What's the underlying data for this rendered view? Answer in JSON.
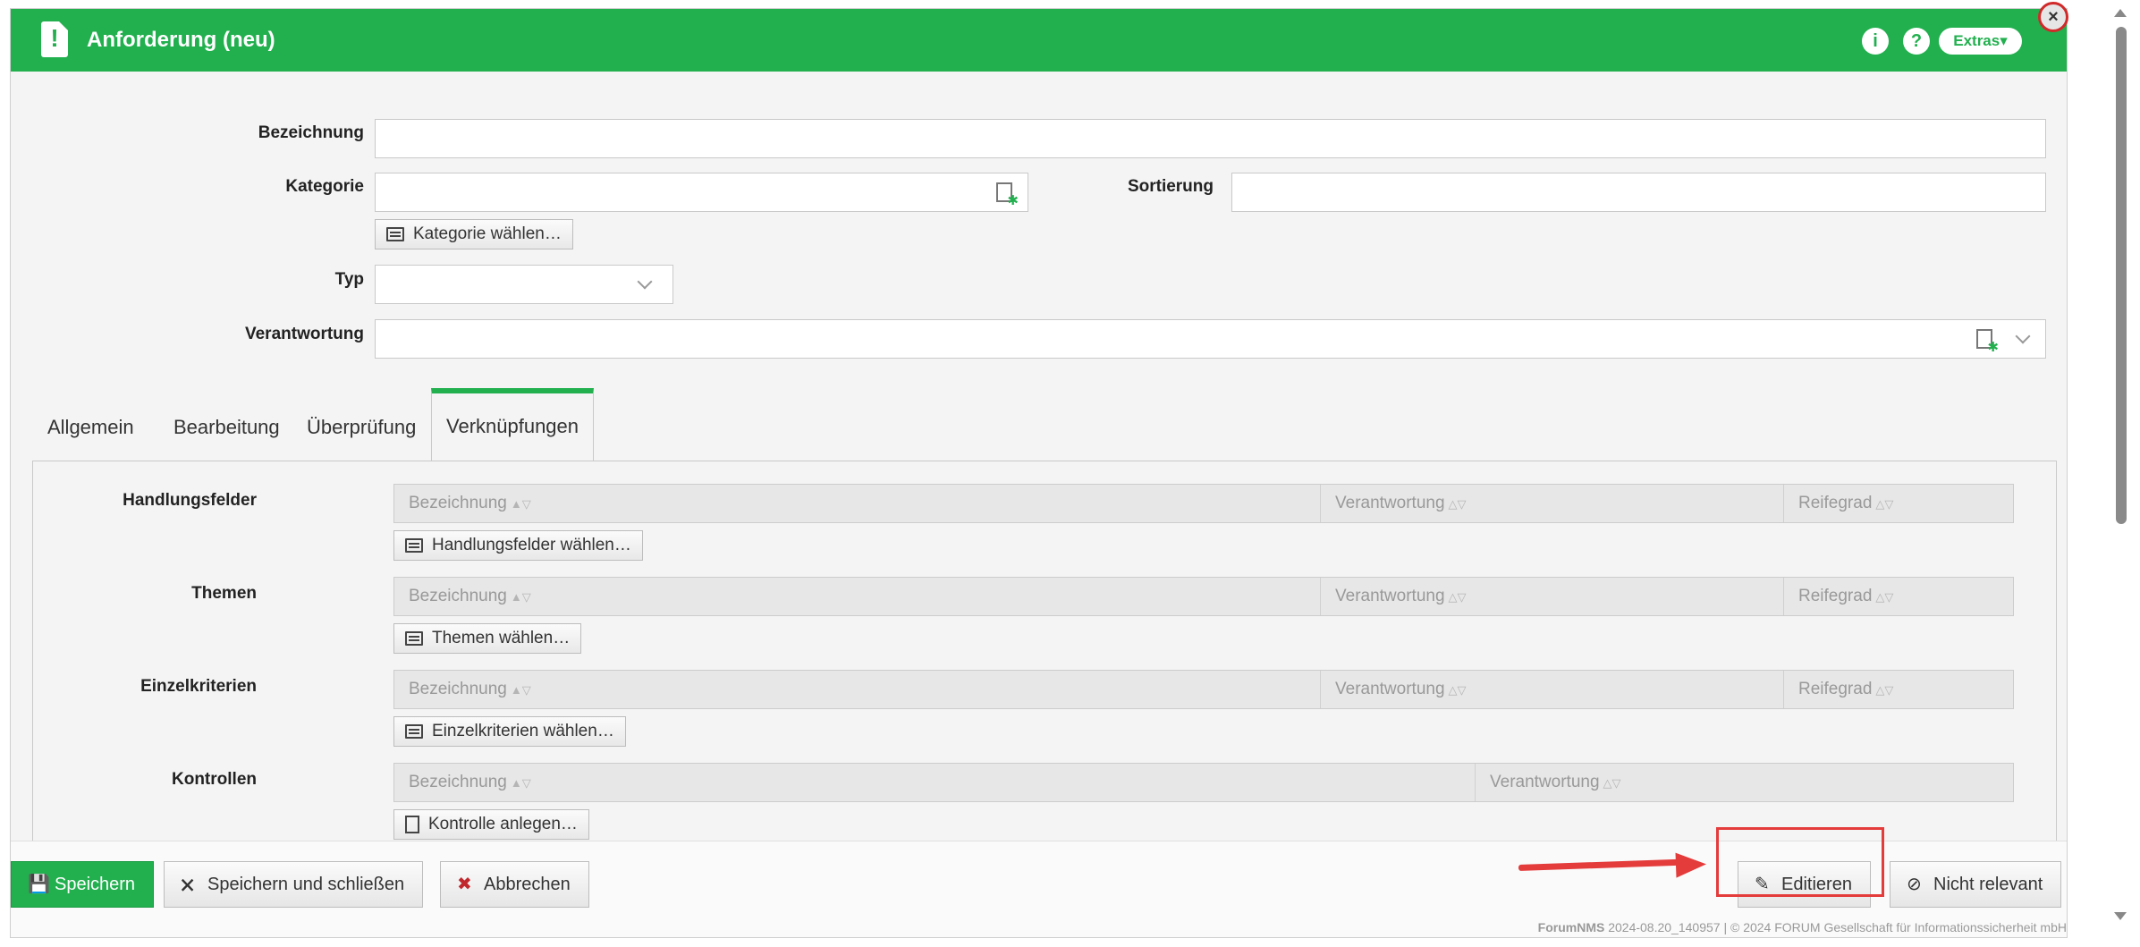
{
  "header": {
    "title": "Anforderung (neu)",
    "info_glyph": "i",
    "help_glyph": "?",
    "extras_label": "Extras",
    "extras_caret": "▾",
    "close_glyph": "×",
    "title_icon": "document-exclamation-icon",
    "accent_color": "#22b04f"
  },
  "form": {
    "bezeichnung_label": "Bezeichnung",
    "bezeichnung_value": "",
    "kategorie_label": "Kategorie",
    "kategorie_value": "",
    "kategorie_button": "Kategorie wählen…",
    "sortierung_label": "Sortierung",
    "sortierung_value": "",
    "typ_label": "Typ",
    "typ_value": "",
    "verantwortung_label": "Verantwortung",
    "verantwortung_value": ""
  },
  "tabs": [
    {
      "label": "Allgemein",
      "active": false
    },
    {
      "label": "Bearbeitung",
      "active": false
    },
    {
      "label": "Überprüfung",
      "active": false
    },
    {
      "label": "Verknüpfungen",
      "active": true
    }
  ],
  "sections": {
    "handlungsfelder": {
      "label": "Handlungsfelder",
      "columns": [
        "Bezeichnung",
        "Verantwortung",
        "Reifegrad"
      ],
      "button": "Handlungsfelder wählen…"
    },
    "themen": {
      "label": "Themen",
      "columns": [
        "Bezeichnung",
        "Verantwortung",
        "Reifegrad"
      ],
      "button": "Themen wählen…"
    },
    "einzelkriterien": {
      "label": "Einzelkriterien",
      "columns": [
        "Bezeichnung",
        "Verantwortung",
        "Reifegrad"
      ],
      "button": "Einzelkriterien wählen…"
    },
    "kontrollen": {
      "label": "Kontrollen",
      "columns": [
        "Bezeichnung",
        "Verantwortung"
      ],
      "button": "Kontrolle anlegen…"
    }
  },
  "footer": {
    "save": "Speichern",
    "save_close": "Speichern und schließen",
    "cancel": "Abbrechen",
    "edit": "Editieren",
    "not_relevant": "Nicht relevant",
    "product": "ForumNMS",
    "version": "2024-08.20_140957",
    "separator": "|",
    "copyright": "© 2024 FORUM Gesellschaft für Informationssicherheit mbH",
    "highlight_color": "#e43b3b"
  },
  "sort_glyphs": {
    "asc": "▲▽",
    "none": "△▽"
  }
}
